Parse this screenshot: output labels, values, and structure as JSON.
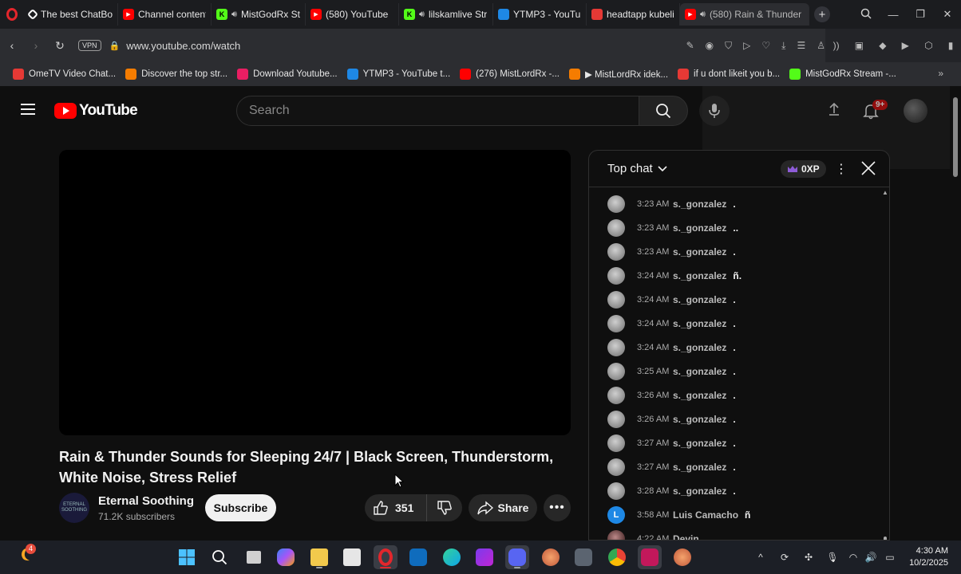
{
  "browser": {
    "tabs": [
      {
        "label": "The best ChatBot",
        "icon": "chatbot-icon",
        "color": "#ffffff"
      },
      {
        "label": "Channel content",
        "icon": "youtube-icon",
        "color": "#ff0000"
      },
      {
        "label": "MistGodRx St",
        "icon": "kick-icon",
        "color": "#53fc18",
        "speaker": true
      },
      {
        "label": "(580) YouTube",
        "icon": "youtube-icon",
        "color": "#ff0000",
        "playing": true
      },
      {
        "label": "lilskamlive Str",
        "icon": "kick-icon",
        "color": "#53fc18",
        "speaker": true
      },
      {
        "label": "YTMP3 - YouTube",
        "icon": "ytmp3-icon",
        "color": "#1e88e5"
      },
      {
        "label": "headtapp kubelis",
        "icon": "app-icon",
        "color": "#e53935"
      },
      {
        "label": "(580) Rain & Thunder",
        "icon": "youtube-icon",
        "color": "#ff0000",
        "speaker": true,
        "active": true
      }
    ],
    "url": "www.youtube.com/watch",
    "vpn_label": "VPN",
    "bookmarks": [
      {
        "label": "OmeTV Video Chat...",
        "color": "#e53935"
      },
      {
        "label": "Discover the top str...",
        "color": "#f57c00"
      },
      {
        "label": "Download Youtube...",
        "color": "#e91e63"
      },
      {
        "label": "YTMP3 - YouTube t...",
        "color": "#1e88e5"
      },
      {
        "label": "(276) MistLordRx -...",
        "color": "#ff0000"
      },
      {
        "label": "▶ MistLordRx idek...",
        "color": "#f57c00"
      },
      {
        "label": "if u dont likeit you b...",
        "color": "#e53935"
      },
      {
        "label": "MistGodRx Stream -...",
        "color": "#53fc18"
      }
    ]
  },
  "youtube": {
    "logo_text": "YouTube",
    "search_placeholder": "Search",
    "notifications_badge": "9+",
    "video": {
      "title": "Rain & Thunder Sounds for Sleeping 24/7 | Black Screen, Thunderstorm, White Noise, Stress Relief",
      "channel_name": "Eternal Soothing",
      "channel_avatar_text": "ETERNAL SOOTHING",
      "subscribers": "71.2K subscribers",
      "subscribe_label": "Subscribe",
      "likes": "351",
      "share_label": "Share"
    },
    "chat": {
      "title": "Top chat",
      "xp_label": "0XP",
      "messages": [
        {
          "time": "3:23 AM",
          "user": "s._gonzalez",
          "text": "."
        },
        {
          "time": "3:23 AM",
          "user": "s._gonzalez",
          "text": ".."
        },
        {
          "time": "3:23 AM",
          "user": "s._gonzalez",
          "text": "."
        },
        {
          "time": "3:24 AM",
          "user": "s._gonzalez",
          "text": "ñ."
        },
        {
          "time": "3:24 AM",
          "user": "s._gonzalez",
          "text": "."
        },
        {
          "time": "3:24 AM",
          "user": "s._gonzalez",
          "text": "."
        },
        {
          "time": "3:24 AM",
          "user": "s._gonzalez",
          "text": "."
        },
        {
          "time": "3:25 AM",
          "user": "s._gonzalez",
          "text": "."
        },
        {
          "time": "3:26 AM",
          "user": "s._gonzalez",
          "text": "."
        },
        {
          "time": "3:26 AM",
          "user": "s._gonzalez",
          "text": "."
        },
        {
          "time": "3:27 AM",
          "user": "s._gonzalez",
          "text": "."
        },
        {
          "time": "3:27 AM",
          "user": "s._gonzalez",
          "text": "."
        },
        {
          "time": "3:28 AM",
          "user": "s._gonzalez",
          "text": "."
        },
        {
          "time": "3:58 AM",
          "user": "Luis Camacho",
          "text": "ñ",
          "avatar_letter": "L"
        },
        {
          "time": "4:22 AM",
          "user": "Devin",
          "text": "."
        }
      ]
    }
  },
  "taskbar": {
    "weather_badge": "4",
    "time": "4:30 AM",
    "date": "10/2/2025"
  }
}
